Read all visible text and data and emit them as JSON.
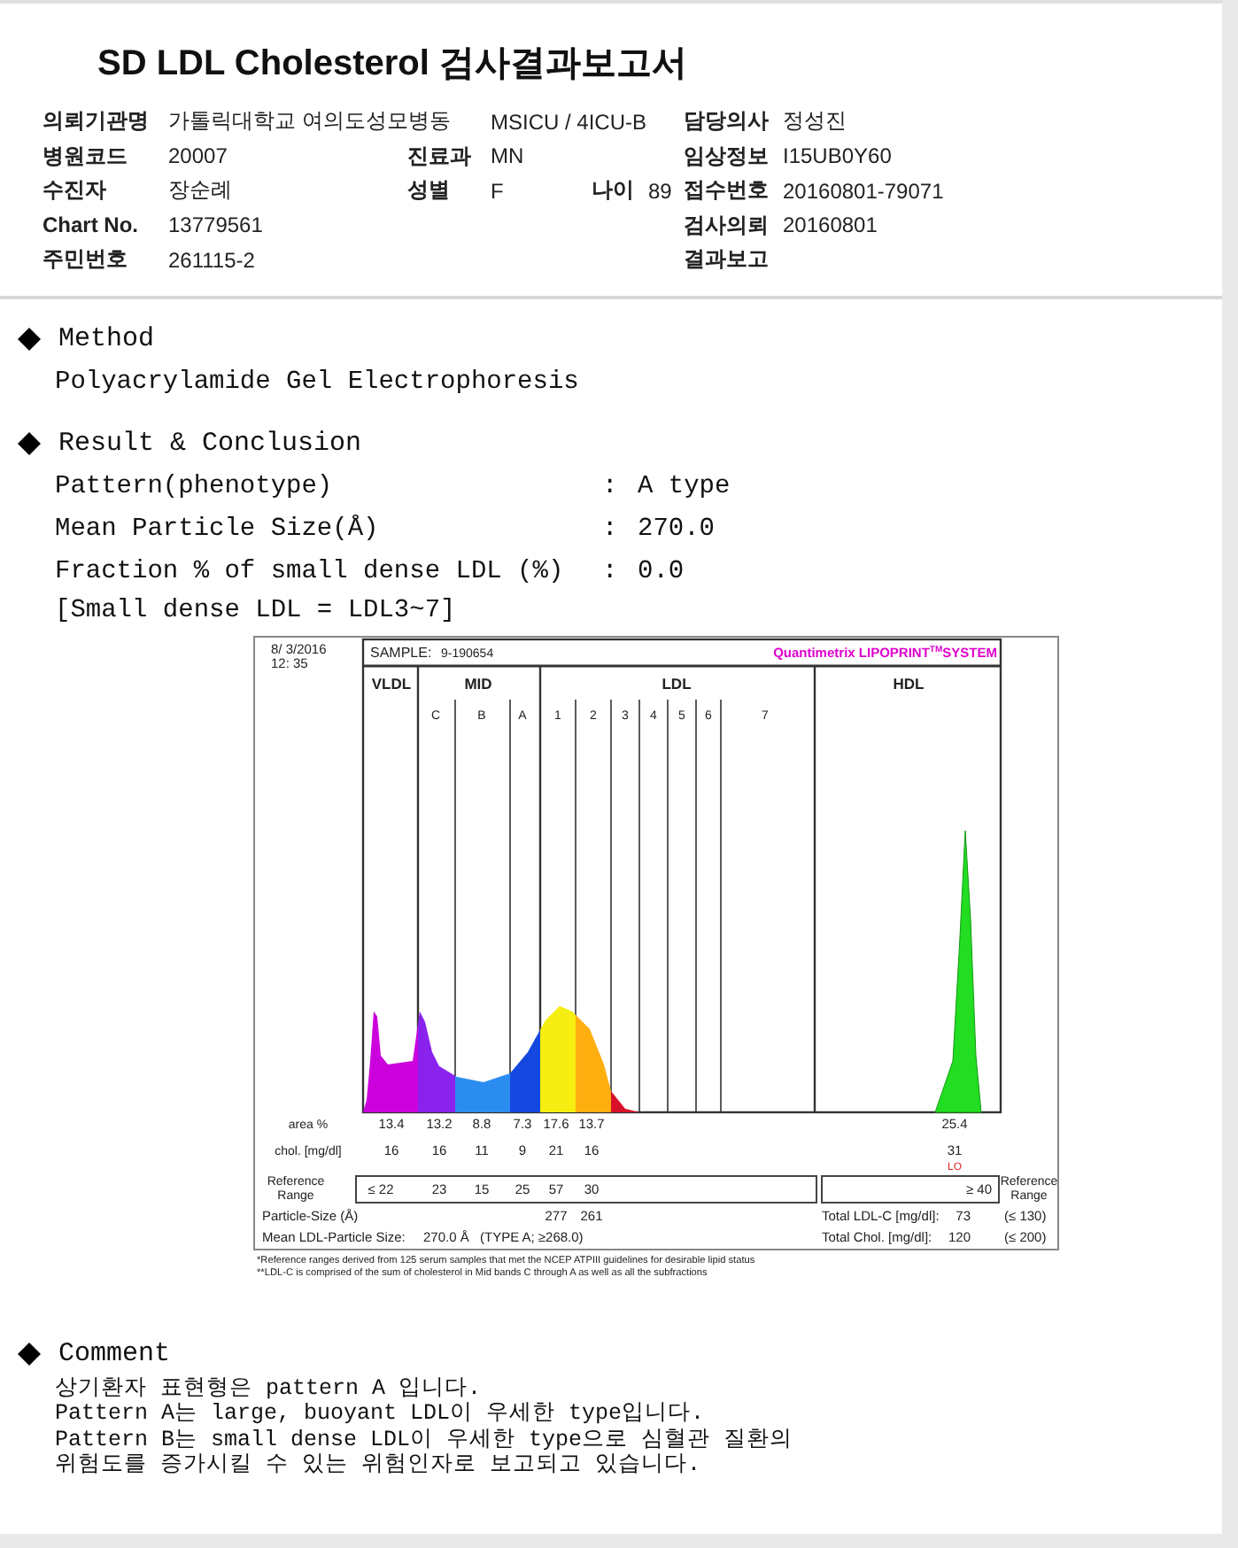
{
  "title": "SD LDL Cholesterol 검사결과보고서",
  "info_rows": [
    {
      "left": {
        "label": "의뢰기관명",
        "value": "가톨릭대학교 여의도성모병동"
      },
      "middle": {
        "value": "MSICU / 4ICU-B"
      },
      "right": {
        "label": "담당의사",
        "value": "정성진"
      }
    },
    {
      "left": {
        "label": "병원코드",
        "value": "20007"
      },
      "middle": {
        "label": "진료과",
        "value": "MN"
      },
      "right": {
        "label": "임상정보",
        "value": "I15UB0Y60"
      }
    },
    {
      "left": {
        "label": "수진자",
        "value": "장순례"
      },
      "middle": {
        "label": "성별",
        "value": "F"
      },
      "extra": {
        "label": "나이",
        "value": "89"
      },
      "right": {
        "label": "접수번호",
        "value": "20160801-79071"
      }
    },
    {
      "left": {
        "label": "Chart No.",
        "value": "13779561"
      },
      "right": {
        "label": "검사의뢰",
        "value": "20160801"
      }
    },
    {
      "left": {
        "label": "주민번호",
        "value": "261115-2"
      },
      "right": {
        "label": "결과보고"
      }
    }
  ],
  "method": {
    "heading": "Method",
    "text": "Polyacrylamide Gel Electrophoresis"
  },
  "result": {
    "heading": "Result & Conclusion",
    "items": [
      {
        "label": "Pattern(phenotype)",
        "sep": ":",
        "value": "A type"
      },
      {
        "label": "Mean Particle Size(Å)",
        "sep": ":",
        "value": "270.0"
      },
      {
        "label": "Fraction % of small dense LDL (%)",
        "sep": ":",
        "value": "0.0"
      }
    ],
    "note": "[Small dense LDL = LDL3~7]"
  },
  "lipoprint": {
    "date": "8/ 3/2016",
    "time": "12: 35",
    "sample_label": "SAMPLE:",
    "sample_id": "9-190654",
    "brand": "Quantimetrix LIPOPRINT",
    "brand_mark": "TM",
    "brand_suffix": "SYSTEM",
    "groups": [
      "VLDL",
      "MID",
      "LDL",
      "HDL"
    ],
    "bands": [
      "C",
      "B",
      "A",
      "1",
      "2",
      "3",
      "4",
      "5",
      "6",
      "7"
    ],
    "rows": [
      {
        "label": "area %",
        "values": [
          "13.4",
          "13.2",
          "8.8",
          "7.3",
          "17.6",
          "13.7"
        ],
        "hdl": "25.4"
      },
      {
        "label": "chol. [mg/dl]",
        "values": [
          "16",
          "16",
          "11",
          "9",
          "21",
          "16"
        ],
        "hdl": "31",
        "flag": "LO"
      }
    ],
    "reference": {
      "label": "Reference Range",
      "values": [
        "≤ 22",
        "23",
        "15",
        "25",
        "57",
        "30"
      ],
      "hdl": "≥ 40",
      "right_label": "Reference Range"
    },
    "particle_size": {
      "label": "Particle-Size (Å)",
      "values": [
        "277",
        "261"
      ]
    },
    "mean_size": {
      "label": "Mean LDL-Particle Size:",
      "value": "270.0 Å",
      "type": "(TYPE A; ≥268.0)"
    },
    "totals": [
      {
        "label": "Total LDL-C [mg/dl]:",
        "value": "73",
        "range": "(≤ 130)"
      },
      {
        "label": "Total Chol. [mg/dl]:",
        "value": "120",
        "range": "(≤ 200)"
      }
    ],
    "footnotes": [
      "*Reference ranges derived from 125 serum samples that met the NCEP ATPIII guidelines for desirable lipid status",
      "**LDL-C is comprised of the sum of cholesterol in Mid bands C through A as well as all the subfractions"
    ]
  },
  "comment": {
    "heading": "Comment",
    "lines": [
      "상기환자 표현형은 pattern A 입니다.",
      "Pattern A는 large, buoyant LDL이 우세한 type입니다.",
      "Pattern B는 small dense LDL이 우세한 type으로 심혈관 질환의",
      "위험도를 증가시킬 수 있는 위험인자로 보고되고 있습니다."
    ]
  }
}
